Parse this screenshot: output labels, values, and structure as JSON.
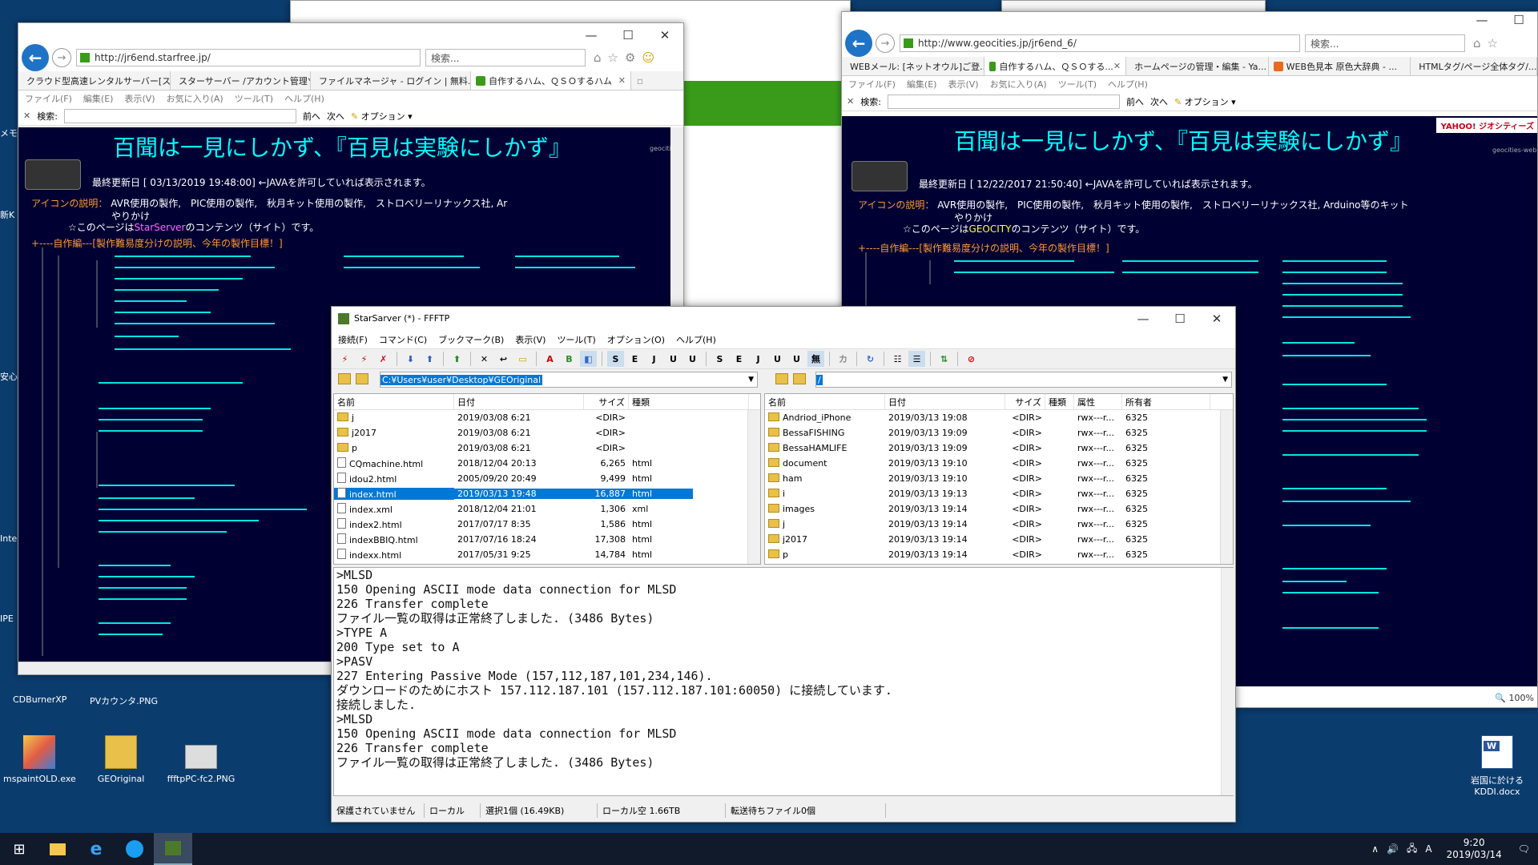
{
  "desktop": {
    "bg_color": "#0b3c6e",
    "left_labels": [
      "メモ",
      "新K",
      "安心",
      "Inte",
      "IPE"
    ],
    "captions": [
      "CDBurnerXP",
      "PVカウンタ.PNG"
    ],
    "icons": [
      {
        "label": "mspaintOLD.exe",
        "icon": "paint-icon"
      },
      {
        "label": "GEOriginal",
        "icon": "folder-icon"
      },
      {
        "label": "ffftpPC-fc2.PNG",
        "icon": "image-file-icon"
      },
      {
        "label": "岩国に於ける\nKDDI.docx",
        "icon": "word-doc-icon"
      }
    ]
  },
  "taskbar": {
    "time": "9:20",
    "date": "2019/03/14",
    "ime": "A"
  },
  "browser_left": {
    "url": "http://jr6end.starfree.jp/",
    "search_placeholder": "検索...",
    "tabs": [
      "クラウド型高速レンタルサーバー[ス...",
      "スターサーバー /アカウント管理ツール",
      "ファイルマネージャ - ログイン | 無料...",
      "自作するハム、ＱＳＯするハム"
    ],
    "menu": [
      "ファイル(F)",
      "編集(E)",
      "表示(V)",
      "お気に入り(A)",
      "ツール(T)",
      "ヘルプ(H)"
    ],
    "find_label": "検索:",
    "find_prev": "前へ",
    "find_next": "次へ",
    "find_options": "オプション",
    "page": {
      "headline": "百聞は一見にしかず、『百見は実験にしかず』",
      "small_tag": "geocitie",
      "updated": "最終更新日 [ 03/13/2019 19:48:00] ←JAVAを許可していれば表示されます。",
      "icon_legend_label": "アイコンの説明：",
      "icon_legend": "AVR使用の製作,　PIC使用の製作,　秋月キット使用の製作,　ストロベリーリナックス社, Ar",
      "yarikake": "やりかけ",
      "content_prefix": "☆このページは",
      "content_brand": "StarServer",
      "content_suffix": "のコンテンツ（サイト）です。",
      "jisaku": "+----自作編---[製作難易度分けの説明、今年の製作目標！]"
    }
  },
  "browser_right": {
    "url": "http://www.geocities.jp/jr6end_6/",
    "search_placeholder": "検索...",
    "tabs": [
      "WEBメール: [ネットオウル]ご登...",
      "自作するハム、ＱＳＯする...",
      "ホームページの管理・編集 - Ya...",
      "WEB色見本 原色大辞典 - ...",
      "HTMLタグ/ページ全体タグ/..."
    ],
    "menu": [
      "ファイル(F)",
      "編集(E)",
      "表示(V)",
      "お気に入り(A)",
      "ツール(T)",
      "ヘルプ(H)"
    ],
    "find_label": "検索:",
    "find_prev": "前へ",
    "find_next": "次へ",
    "find_options": "オプション",
    "yahoo": "YAHOO! ジオシティーズ",
    "zoom": "100%",
    "page": {
      "headline": "百聞は一見にしかず、『百見は実験にしかず』",
      "small_tag": "geocities-web",
      "updated": "最終更新日 [ 12/22/2017 21:50:40] ←JAVAを許可していれば表示されます。",
      "icon_legend_label": "アイコンの説明：",
      "icon_legend": "AVR使用の製作,　PIC使用の製作,　秋月キット使用の製作,　ストロベリーリナックス社, Arduino等のキット",
      "yarikake": "やりかけ",
      "content_prefix": "☆このページは",
      "content_brand": "GEOCITY",
      "content_suffix": "のコンテンツ（サイト）です。",
      "jisaku": "+----自作編---[製作難易度分けの説明、今年の製作目標！]"
    }
  },
  "ffftp": {
    "title": "StarSarver (*) - FFFTP",
    "menu": [
      "接続(F)",
      "コマンド(C)",
      "ブックマーク(B)",
      "表示(V)",
      "ツール(T)",
      "オプション(O)",
      "ヘルプ(H)"
    ],
    "local_path": "C:¥Users¥user¥Desktop¥GEOriginal",
    "remote_path": "/",
    "local_headers": [
      "名前",
      "日付",
      "サイズ",
      "種類"
    ],
    "remote_headers": [
      "名前",
      "日付",
      "サイズ",
      "種類",
      "属性",
      "所有者"
    ],
    "local_files": [
      {
        "name": "j",
        "date": "2019/03/08  6:21",
        "size": "<DIR>",
        "type": "",
        "kind": "folder"
      },
      {
        "name": "j2017",
        "date": "2019/03/08  6:21",
        "size": "<DIR>",
        "type": "",
        "kind": "folder"
      },
      {
        "name": "p",
        "date": "2019/03/08  6:21",
        "size": "<DIR>",
        "type": "",
        "kind": "folder"
      },
      {
        "name": "CQmachine.html",
        "date": "2018/12/04 20:13",
        "size": "6,265",
        "type": "html",
        "kind": "file"
      },
      {
        "name": "idou2.html",
        "date": "2005/09/20 20:49",
        "size": "9,499",
        "type": "html",
        "kind": "file"
      },
      {
        "name": "index.html",
        "date": "2019/03/13 19:48",
        "size": "16,887",
        "type": "html",
        "kind": "file",
        "selected": true
      },
      {
        "name": "index.xml",
        "date": "2018/12/04 21:01",
        "size": "1,306",
        "type": "xml",
        "kind": "file"
      },
      {
        "name": "index2.html",
        "date": "2017/07/17  8:35",
        "size": "1,586",
        "type": "html",
        "kind": "file"
      },
      {
        "name": "indexBBIQ.html",
        "date": "2017/07/16 18:24",
        "size": "17,308",
        "type": "html",
        "kind": "file"
      },
      {
        "name": "indexx.html",
        "date": "2017/05/31  9:25",
        "size": "14,784",
        "type": "html",
        "kind": "file"
      }
    ],
    "remote_files": [
      {
        "name": "Andriod_iPhone",
        "date": "2019/03/13 19:08",
        "size": "<DIR>",
        "attr": "rwx---r...",
        "owner": "6325"
      },
      {
        "name": "BessaFISHING",
        "date": "2019/03/13 19:09",
        "size": "<DIR>",
        "attr": "rwx---r...",
        "owner": "6325"
      },
      {
        "name": "BessaHAMLIFE",
        "date": "2019/03/13 19:09",
        "size": "<DIR>",
        "attr": "rwx---r...",
        "owner": "6325"
      },
      {
        "name": "document",
        "date": "2019/03/13 19:10",
        "size": "<DIR>",
        "attr": "rwx---r...",
        "owner": "6325"
      },
      {
        "name": "ham",
        "date": "2019/03/13 19:10",
        "size": "<DIR>",
        "attr": "rwx---r...",
        "owner": "6325"
      },
      {
        "name": "i",
        "date": "2019/03/13 19:13",
        "size": "<DIR>",
        "attr": "rwx---r...",
        "owner": "6325"
      },
      {
        "name": "images",
        "date": "2019/03/13 19:14",
        "size": "<DIR>",
        "attr": "rwx---r...",
        "owner": "6325"
      },
      {
        "name": "j",
        "date": "2019/03/13 19:14",
        "size": "<DIR>",
        "attr": "rwx---r...",
        "owner": "6325"
      },
      {
        "name": "j2017",
        "date": "2019/03/13 19:14",
        "size": "<DIR>",
        "attr": "rwx---r...",
        "owner": "6325"
      },
      {
        "name": "p",
        "date": "2019/03/13 19:14",
        "size": "<DIR>",
        "attr": "rwx---r...",
        "owner": "6325"
      }
    ],
    "log": [
      ">MLSD",
      "150 Opening ASCII mode data connection for MLSD",
      "226 Transfer complete",
      "ファイル一覧の取得は正常終了しました. (3486 Bytes)",
      ">TYPE A",
      "200 Type set to A",
      ">PASV",
      "227 Entering Passive Mode (157,112,187,101,234,146).",
      "ダウンロードのためにホスト 157.112.187.101 (157.112.187.101:60050) に接続しています.",
      "接続しました.",
      ">MLSD",
      "150 Opening ASCII mode data connection for MLSD",
      "226 Transfer complete",
      "ファイル一覧の取得は正常終了しました. (3486 Bytes)"
    ],
    "status": [
      "保護されていません",
      "ローカル",
      "選択1個 (16.49KB)",
      "ローカル空 1.66TB",
      "転送待ちファイル0個"
    ]
  }
}
